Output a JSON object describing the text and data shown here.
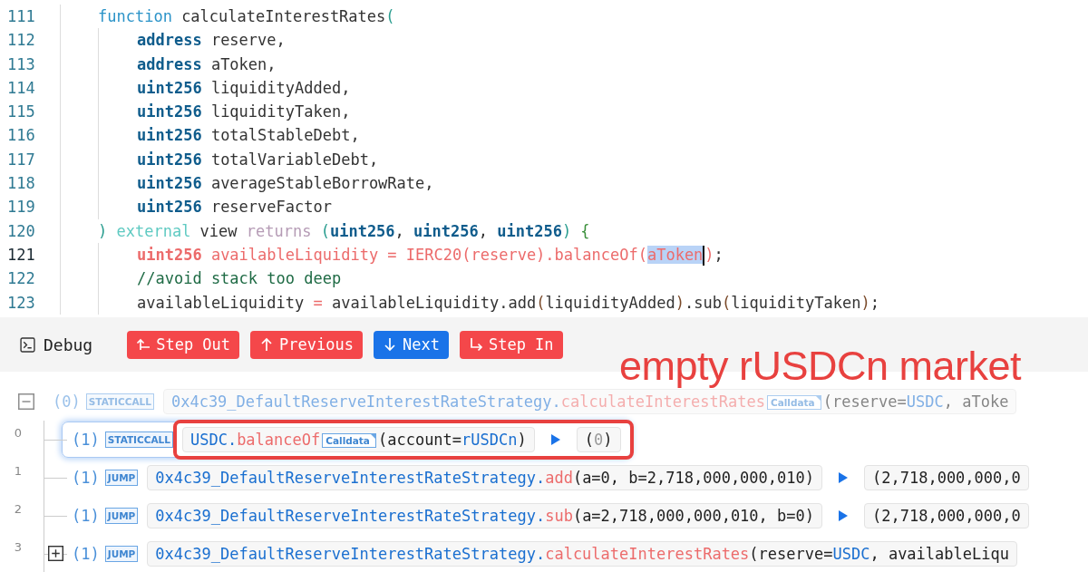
{
  "code": {
    "lines": [
      {
        "number": "111",
        "kind": "signature",
        "active": false,
        "tokens": [
          {
            "text": "function",
            "kind": "keyword"
          },
          {
            "text": " calculateInterestRates",
            "kind": "plain"
          },
          {
            "text": "(",
            "kind": "paren"
          }
        ]
      },
      {
        "number": "112",
        "kind": "param",
        "active": false,
        "tokens": [
          {
            "text": "address",
            "kind": "type"
          },
          {
            "text": " reserve,",
            "kind": "plain"
          }
        ]
      },
      {
        "number": "113",
        "kind": "param",
        "active": false,
        "tokens": [
          {
            "text": "address",
            "kind": "type"
          },
          {
            "text": " aToken,",
            "kind": "plain"
          }
        ]
      },
      {
        "number": "114",
        "kind": "param",
        "active": false,
        "tokens": [
          {
            "text": "uint256",
            "kind": "type"
          },
          {
            "text": " liquidityAdded,",
            "kind": "plain"
          }
        ]
      },
      {
        "number": "115",
        "kind": "param",
        "active": false,
        "tokens": [
          {
            "text": "uint256",
            "kind": "type"
          },
          {
            "text": " liquidityTaken,",
            "kind": "plain"
          }
        ]
      },
      {
        "number": "116",
        "kind": "param",
        "active": false,
        "tokens": [
          {
            "text": "uint256",
            "kind": "type"
          },
          {
            "text": " totalStableDebt,",
            "kind": "plain"
          }
        ]
      },
      {
        "number": "117",
        "kind": "param",
        "active": false,
        "tokens": [
          {
            "text": "uint256",
            "kind": "type"
          },
          {
            "text": " totalVariableDebt,",
            "kind": "plain"
          }
        ]
      },
      {
        "number": "118",
        "kind": "param",
        "active": false,
        "tokens": [
          {
            "text": "uint256",
            "kind": "type"
          },
          {
            "text": " averageStableBorrowRate,",
            "kind": "plain"
          }
        ]
      },
      {
        "number": "119",
        "kind": "param",
        "active": false,
        "tokens": [
          {
            "text": "uint256",
            "kind": "type"
          },
          {
            "text": " reserveFactor",
            "kind": "plain"
          }
        ]
      },
      {
        "number": "120",
        "kind": "signature",
        "active": false,
        "tokens": [
          {
            "text": ")",
            "kind": "paren"
          },
          {
            "text": " external",
            "kind": "modifier"
          },
          {
            "text": " view",
            "kind": "plain"
          },
          {
            "text": " returns",
            "kind": "returns"
          },
          {
            "text": " (",
            "kind": "paren"
          },
          {
            "text": "uint256",
            "kind": "type"
          },
          {
            "text": ", ",
            "kind": "plain"
          },
          {
            "text": "uint256",
            "kind": "type"
          },
          {
            "text": ", ",
            "kind": "plain"
          },
          {
            "text": "uint256",
            "kind": "type"
          },
          {
            "text": ")",
            "kind": "paren"
          },
          {
            "text": " {",
            "kind": "brace"
          }
        ]
      },
      {
        "number": "121",
        "kind": "param",
        "active": true,
        "tokens": [
          {
            "text": "uint256",
            "kind": "active-type"
          },
          {
            "text": " availableLiquidity = IERC20(reserve).balanceOf(",
            "kind": "active"
          },
          {
            "text": "aToken",
            "kind": "selection"
          },
          {
            "text": ")",
            "kind": "active"
          },
          {
            "text": ";",
            "kind": "plain"
          }
        ]
      },
      {
        "number": "122",
        "kind": "param",
        "active": false,
        "tokens": [
          {
            "text": "//avoid stack too deep",
            "kind": "comment"
          }
        ]
      },
      {
        "number": "123",
        "kind": "param",
        "active": false,
        "tokens": [
          {
            "text": "availableLiquidity ",
            "kind": "plain"
          },
          {
            "text": "=",
            "kind": "operator"
          },
          {
            "text": " availableLiquidity.add",
            "kind": "plain"
          },
          {
            "text": "(",
            "kind": "punct"
          },
          {
            "text": "liquidityAdded",
            "kind": "plain"
          },
          {
            "text": ")",
            "kind": "punct"
          },
          {
            "text": ".sub",
            "kind": "plain"
          },
          {
            "text": "(",
            "kind": "punct"
          },
          {
            "text": "liquidityTaken",
            "kind": "plain"
          },
          {
            "text": ")",
            "kind": "punct"
          },
          {
            "text": ";",
            "kind": "plain"
          }
        ]
      }
    ]
  },
  "debug": {
    "title": "Debug",
    "buttons": [
      {
        "label": "Step Out",
        "kind": "step-out",
        "color": "#f4474a"
      },
      {
        "label": "Previous",
        "kind": "previous",
        "color": "#f4474a"
      },
      {
        "label": "Next",
        "kind": "next",
        "color": "#1a73e8"
      },
      {
        "label": "Step In",
        "kind": "step-in",
        "color": "#f4474a"
      }
    ]
  },
  "annotation": {
    "text": "empty rUSDCn market"
  },
  "trace": {
    "rows": [
      {
        "kind": "expanded",
        "depth": "(0)",
        "op": "STATICCALL",
        "selected": false,
        "faded": true,
        "marked": false,
        "call": [
          {
            "text": "0x4c39_DefaultReserveInterestRateStrategy.",
            "kind": "contract"
          },
          {
            "text": "calculateInterestRates",
            "kind": "method"
          },
          {
            "text": "Calldata",
            "kind": "calldata"
          },
          {
            "text": "(reserve=",
            "kind": "plain"
          },
          {
            "text": "USDC",
            "kind": "value"
          },
          {
            "text": ", aToke",
            "kind": "plain"
          }
        ]
      },
      {
        "index": "0",
        "kind": "leaf",
        "depth": "(1)",
        "op": "STATICCALL",
        "selected": true,
        "faded": false,
        "marked": true,
        "call": [
          {
            "text": "USDC.",
            "kind": "contract"
          },
          {
            "text": "balanceOf",
            "kind": "method"
          },
          {
            "text": "Calldata",
            "kind": "calldata"
          },
          {
            "text": "(account=",
            "kind": "plain"
          },
          {
            "text": "rUSDCn",
            "kind": "value"
          },
          {
            "text": ")",
            "kind": "plain"
          }
        ],
        "result": [
          {
            "text": "(",
            "kind": "plain"
          },
          {
            "text": "0",
            "kind": "muted"
          },
          {
            "text": ")",
            "kind": "plain"
          }
        ]
      },
      {
        "index": "1",
        "kind": "leaf",
        "depth": "(1)",
        "op": "JUMP",
        "selected": false,
        "faded": false,
        "marked": false,
        "call": [
          {
            "text": "0x4c39_DefaultReserveInterestRateStrategy.",
            "kind": "contract"
          },
          {
            "text": "add",
            "kind": "method"
          },
          {
            "text": "(a=0, b=2,718,000,000,010)",
            "kind": "plain"
          }
        ],
        "result": [
          {
            "text": "(2,718,000,000,0",
            "kind": "plain"
          }
        ]
      },
      {
        "index": "2",
        "kind": "leaf",
        "depth": "(1)",
        "op": "JUMP",
        "selected": false,
        "faded": false,
        "marked": false,
        "call": [
          {
            "text": "0x4c39_DefaultReserveInterestRateStrategy.",
            "kind": "contract"
          },
          {
            "text": "sub",
            "kind": "method"
          },
          {
            "text": "(a=2,718,000,000,010, b=0)",
            "kind": "plain"
          }
        ],
        "result": [
          {
            "text": "(2,718,000,000,0",
            "kind": "plain"
          }
        ]
      },
      {
        "index": "3",
        "kind": "collapsed",
        "depth": "(1)",
        "op": "JUMP",
        "selected": false,
        "faded": false,
        "marked": false,
        "call": [
          {
            "text": "0x4c39_DefaultReserveInterestRateStrategy.",
            "kind": "contract"
          },
          {
            "text": "calculateInterestRates",
            "kind": "method"
          },
          {
            "text": "(reserve=",
            "kind": "plain"
          },
          {
            "text": "USDC",
            "kind": "value"
          },
          {
            "text": ", availableLiqu",
            "kind": "plain"
          }
        ]
      }
    ]
  }
}
